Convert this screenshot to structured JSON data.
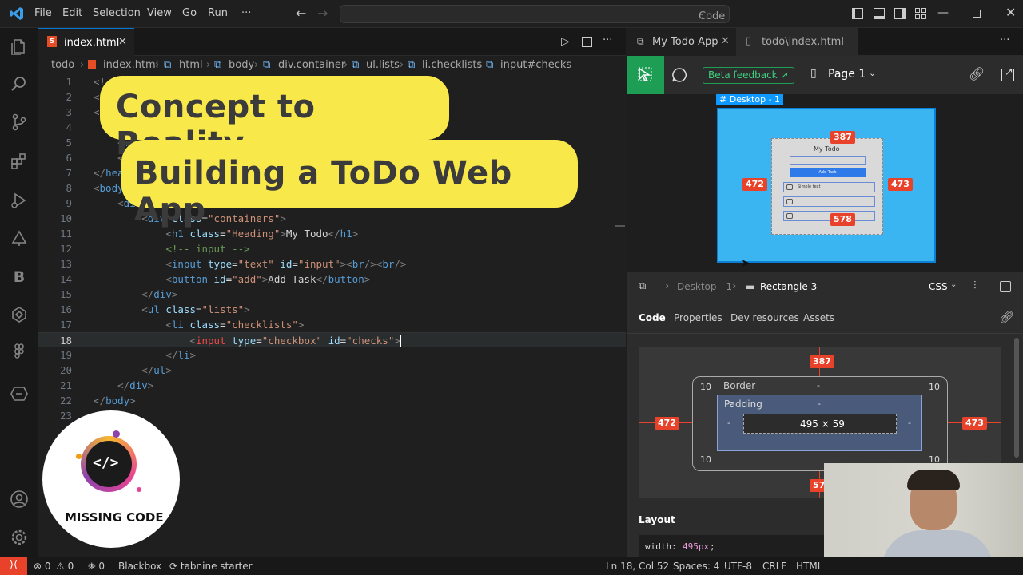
{
  "titlebar": {
    "menu": [
      "File",
      "Edit",
      "Selection",
      "View",
      "Go",
      "Run",
      "···"
    ],
    "search": "Code"
  },
  "editor": {
    "tab_label": "index.html",
    "breadcrumb": [
      "todo",
      "index.html",
      "html",
      "body",
      "div.container",
      "ul.lists",
      "li.checklists",
      "input#checks"
    ]
  },
  "banners": {
    "line1": "Concept to Reality",
    "line2": "Building a ToDo Web App"
  },
  "logo": {
    "text": "MISSING CODE",
    "glyph": "</>"
  },
  "right_panel": {
    "tabs": [
      "My Todo App",
      "todo\\index.html"
    ],
    "beta_feedback": "Beta feedback",
    "page_label": "Page 1",
    "frame_label": "Desktop - 1",
    "mock_heading": "My Todo",
    "mock_button": "Add Task",
    "mock_item_text": "Simple text",
    "measure_top": "387",
    "measure_left": "472",
    "measure_right": "473",
    "measure_bottom": "578",
    "inspector_crumb_parent": "Desktop - 1",
    "inspector_crumb_current": "Rectangle 3",
    "inspector_lang": "CSS",
    "inspector_tabs": [
      "Code",
      "Properties",
      "Dev resources",
      "Assets"
    ],
    "box_border_label": "Border",
    "box_padding_label": "Padding",
    "box_size": "495 × 59",
    "box_corner": "10",
    "box_dash": "-",
    "layout_label": "Layout",
    "css_line_prop": "width:",
    "css_line_val": "495px",
    "css_line_end": ";"
  },
  "statusbar": {
    "problems": "0",
    "warnings": "0",
    "ports": "0",
    "blackbox": "Blackbox",
    "tabnine": "tabnine starter",
    "position": "Ln 18, Col 52",
    "spaces": "Spaces: 4",
    "encoding": "UTF-8",
    "eol": "CRLF",
    "language": "HTML"
  },
  "colors": {
    "banner_yellow": "#f9e84a",
    "accent_red": "#e8432a",
    "figma_green": "#1e9e55",
    "canvas_blue": "#3bb4f2"
  }
}
